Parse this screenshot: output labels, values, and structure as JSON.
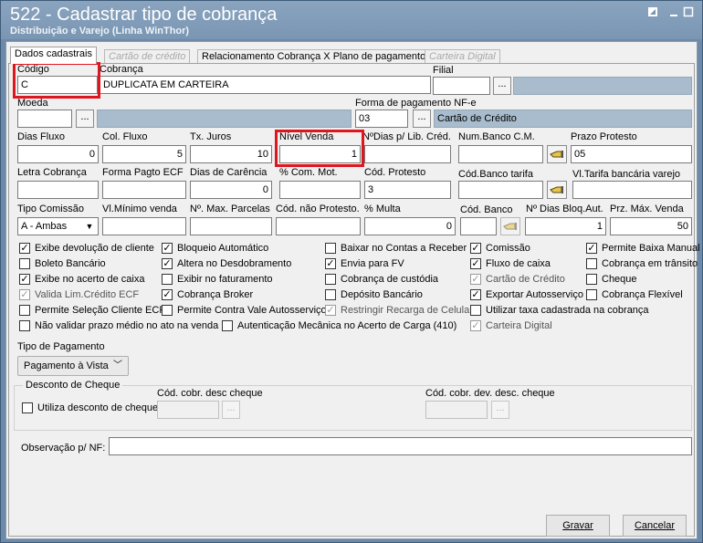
{
  "window": {
    "title": "522 - Cadastrar tipo de cobrança",
    "subtitle": "Distribuição e Varejo (Linha WinThor)"
  },
  "tabs": [
    {
      "label": "Dados cadastrais",
      "state": "active"
    },
    {
      "label": "Cartão de crédito",
      "state": "disabled"
    },
    {
      "label": "Relacionamento Cobrança X Plano de pagamento",
      "state": "normal"
    },
    {
      "label": "Carteira Digital",
      "state": "disabled"
    }
  ],
  "fields": {
    "codigo": {
      "label": "Código",
      "value": "C"
    },
    "cobranca": {
      "label": "Cobrança",
      "value": "DUPLICATA EM CARTEIRA"
    },
    "filial": {
      "label": "Filial",
      "value": ""
    },
    "moeda": {
      "label": "Moeda",
      "value": ""
    },
    "forma_pagamento_nfe": {
      "label": "Forma de pagamento NF-e",
      "code": "03",
      "description": "Cartão de Crédito"
    },
    "dias_fluxo": {
      "label": "Dias Fluxo",
      "value": "0"
    },
    "col_fluxo": {
      "label": "Col. Fluxo",
      "value": "5"
    },
    "tx_juros": {
      "label": "Tx. Juros",
      "value": "10"
    },
    "nivel_venda": {
      "label": "Nível Venda",
      "value": "1"
    },
    "n_dias_lib_cred": {
      "label": "NºDias p/ Lib. Créd.",
      "value": ""
    },
    "num_banco_cm": {
      "label": "Num.Banco C.M.",
      "value": ""
    },
    "prazo_protesto": {
      "label": "Prazo Protesto",
      "value": "05"
    },
    "letra_cobranca": {
      "label": "Letra Cobrança",
      "value": ""
    },
    "forma_pagto_ecf": {
      "label": "Forma Pagto ECF",
      "value": ""
    },
    "dias_carencia": {
      "label": "Dias de Carência",
      "value": "0"
    },
    "com_mot": {
      "label": "% Com. Mot.",
      "value": ""
    },
    "cod_protesto": {
      "label": "Cód. Protesto",
      "value": "3"
    },
    "cod_banco_tarifa": {
      "label": "Cód.Banco tarifa",
      "value": ""
    },
    "vl_tarifa_bancaria": {
      "label": "Vl.Tarifa bancária varejo",
      "value": ""
    },
    "tipo_comissao": {
      "label": "Tipo Comissão",
      "value": "A - Ambas"
    },
    "vl_minimo_venda": {
      "label": "Vl.Mínimo venda",
      "value": ""
    },
    "max_parcelas": {
      "label": "Nº. Max. Parcelas",
      "value": ""
    },
    "cod_nao_protesto": {
      "label": "Cód. não Protesto.",
      "value": ""
    },
    "multa": {
      "label": "% Multa",
      "value": "0"
    },
    "cod_banco": {
      "label": "Cód. Banco",
      "value": ""
    },
    "n_dias_bloq_aut": {
      "label": "Nº Dias Bloq.Aut.",
      "value": "1"
    },
    "prz_max_venda": {
      "label": "Prz. Máx. Venda",
      "value": "50"
    }
  },
  "checkboxes": {
    "c1": {
      "label": "Exibe devolução de cliente",
      "checked": true,
      "disabled": false
    },
    "c2": {
      "label": "Boleto Bancário",
      "checked": false,
      "disabled": false
    },
    "c3": {
      "label": "Exibe no acerto de caixa",
      "checked": true,
      "disabled": false
    },
    "c4": {
      "label": "Valida Lim.Crédito ECF",
      "checked": true,
      "disabled": true
    },
    "c5": {
      "label": "Permite Seleção Cliente ECF",
      "checked": false,
      "disabled": false
    },
    "c6": {
      "label": "Não validar prazo médio no ato na venda",
      "checked": false,
      "disabled": false
    },
    "c7": {
      "label": "Bloqueio Automático",
      "checked": true,
      "disabled": false
    },
    "c8": {
      "label": "Altera no Desdobramento",
      "checked": true,
      "disabled": false
    },
    "c9": {
      "label": "Exibir no faturamento",
      "checked": false,
      "disabled": false
    },
    "c10": {
      "label": "Cobrança Broker",
      "checked": true,
      "disabled": false
    },
    "c11": {
      "label": "Permite Contra Vale Autosserviço",
      "checked": false,
      "disabled": false
    },
    "c12": {
      "label": "Autenticação Mecânica no Acerto de Carga (410)",
      "checked": false,
      "disabled": false
    },
    "c13": {
      "label": "Baixar no Contas a Receber",
      "checked": false,
      "disabled": false
    },
    "c14": {
      "label": "Envia para FV",
      "checked": true,
      "disabled": false
    },
    "c15": {
      "label": "Cobrança de custódia",
      "checked": false,
      "disabled": false
    },
    "c16": {
      "label": "Depósito Bancário",
      "checked": false,
      "disabled": false
    },
    "c17": {
      "label": "Restringir Recarga de Celular",
      "checked": true,
      "disabled": true
    },
    "c18": {
      "label": "Comissão",
      "checked": true,
      "disabled": false
    },
    "c19": {
      "label": "Fluxo de caixa",
      "checked": true,
      "disabled": false
    },
    "c20": {
      "label": "Cartão de Crédito",
      "checked": true,
      "disabled": true
    },
    "c21": {
      "label": "Exportar Autosserviço",
      "checked": true,
      "disabled": false
    },
    "c22": {
      "label": "Utilizar taxa cadastrada na cobrança",
      "checked": false,
      "disabled": false
    },
    "c23": {
      "label": "Carteira Digital",
      "checked": true,
      "disabled": true
    },
    "c24": {
      "label": "Permite Baixa Manual",
      "checked": true,
      "disabled": false
    },
    "c25": {
      "label": "Cobrança em trânsito",
      "checked": false,
      "disabled": false
    },
    "c26": {
      "label": "Cheque",
      "checked": false,
      "disabled": false
    },
    "c27": {
      "label": "Cobrança Flexível",
      "checked": false,
      "disabled": false
    }
  },
  "tipo_pagamento": {
    "label": "Tipo de Pagamento",
    "value": "Pagamento à Vista"
  },
  "desconto_cheque": {
    "group_label": "Desconto de Cheque",
    "utiliza_label": "Utiliza desconto de cheque",
    "utiliza_checked": false,
    "cod_desc_label": "Cód. cobr. desc cheque",
    "cod_dev_label": "Cód. cobr. dev. desc. cheque"
  },
  "observacao": {
    "label": "Observação p/ NF:",
    "value": ""
  },
  "buttons": {
    "gravar": "Gravar",
    "cancelar": "Cancelar",
    "ellipsis": "...",
    "check_mark": "✓"
  },
  "colors": {
    "highlight": "#e0161e",
    "titlebar": "#7a96b3",
    "readonly_fill": "#a8bccd"
  }
}
